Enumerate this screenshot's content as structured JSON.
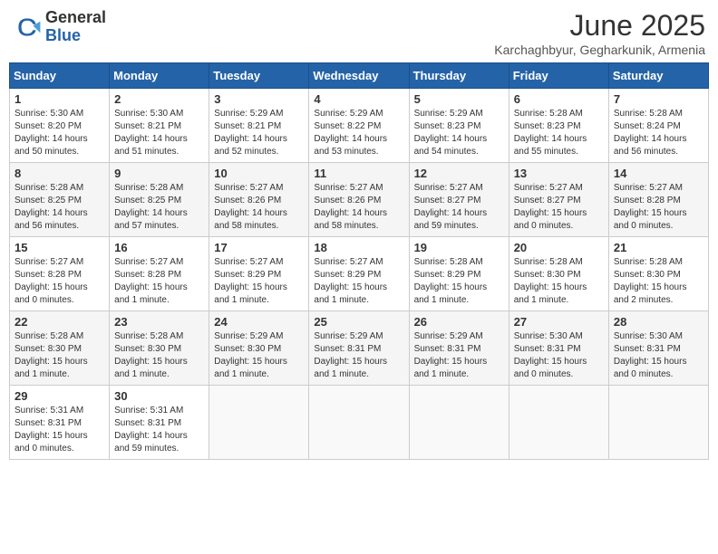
{
  "header": {
    "logo": {
      "general": "General",
      "blue": "Blue"
    },
    "title": "June 2025",
    "location": "Karchaghbyur, Gegharkunik, Armenia"
  },
  "calendar": {
    "days_of_week": [
      "Sunday",
      "Monday",
      "Tuesday",
      "Wednesday",
      "Thursday",
      "Friday",
      "Saturday"
    ],
    "weeks": [
      [
        {
          "day": "1",
          "sunrise": "Sunrise: 5:30 AM",
          "sunset": "Sunset: 8:20 PM",
          "daylight": "Daylight: 14 hours and 50 minutes."
        },
        {
          "day": "2",
          "sunrise": "Sunrise: 5:30 AM",
          "sunset": "Sunset: 8:21 PM",
          "daylight": "Daylight: 14 hours and 51 minutes."
        },
        {
          "day": "3",
          "sunrise": "Sunrise: 5:29 AM",
          "sunset": "Sunset: 8:21 PM",
          "daylight": "Daylight: 14 hours and 52 minutes."
        },
        {
          "day": "4",
          "sunrise": "Sunrise: 5:29 AM",
          "sunset": "Sunset: 8:22 PM",
          "daylight": "Daylight: 14 hours and 53 minutes."
        },
        {
          "day": "5",
          "sunrise": "Sunrise: 5:29 AM",
          "sunset": "Sunset: 8:23 PM",
          "daylight": "Daylight: 14 hours and 54 minutes."
        },
        {
          "day": "6",
          "sunrise": "Sunrise: 5:28 AM",
          "sunset": "Sunset: 8:23 PM",
          "daylight": "Daylight: 14 hours and 55 minutes."
        },
        {
          "day": "7",
          "sunrise": "Sunrise: 5:28 AM",
          "sunset": "Sunset: 8:24 PM",
          "daylight": "Daylight: 14 hours and 56 minutes."
        }
      ],
      [
        {
          "day": "8",
          "sunrise": "Sunrise: 5:28 AM",
          "sunset": "Sunset: 8:25 PM",
          "daylight": "Daylight: 14 hours and 56 minutes."
        },
        {
          "day": "9",
          "sunrise": "Sunrise: 5:28 AM",
          "sunset": "Sunset: 8:25 PM",
          "daylight": "Daylight: 14 hours and 57 minutes."
        },
        {
          "day": "10",
          "sunrise": "Sunrise: 5:27 AM",
          "sunset": "Sunset: 8:26 PM",
          "daylight": "Daylight: 14 hours and 58 minutes."
        },
        {
          "day": "11",
          "sunrise": "Sunrise: 5:27 AM",
          "sunset": "Sunset: 8:26 PM",
          "daylight": "Daylight: 14 hours and 58 minutes."
        },
        {
          "day": "12",
          "sunrise": "Sunrise: 5:27 AM",
          "sunset": "Sunset: 8:27 PM",
          "daylight": "Daylight: 14 hours and 59 minutes."
        },
        {
          "day": "13",
          "sunrise": "Sunrise: 5:27 AM",
          "sunset": "Sunset: 8:27 PM",
          "daylight": "Daylight: 15 hours and 0 minutes."
        },
        {
          "day": "14",
          "sunrise": "Sunrise: 5:27 AM",
          "sunset": "Sunset: 8:28 PM",
          "daylight": "Daylight: 15 hours and 0 minutes."
        }
      ],
      [
        {
          "day": "15",
          "sunrise": "Sunrise: 5:27 AM",
          "sunset": "Sunset: 8:28 PM",
          "daylight": "Daylight: 15 hours and 0 minutes."
        },
        {
          "day": "16",
          "sunrise": "Sunrise: 5:27 AM",
          "sunset": "Sunset: 8:28 PM",
          "daylight": "Daylight: 15 hours and 1 minute."
        },
        {
          "day": "17",
          "sunrise": "Sunrise: 5:27 AM",
          "sunset": "Sunset: 8:29 PM",
          "daylight": "Daylight: 15 hours and 1 minute."
        },
        {
          "day": "18",
          "sunrise": "Sunrise: 5:27 AM",
          "sunset": "Sunset: 8:29 PM",
          "daylight": "Daylight: 15 hours and 1 minute."
        },
        {
          "day": "19",
          "sunrise": "Sunrise: 5:28 AM",
          "sunset": "Sunset: 8:29 PM",
          "daylight": "Daylight: 15 hours and 1 minute."
        },
        {
          "day": "20",
          "sunrise": "Sunrise: 5:28 AM",
          "sunset": "Sunset: 8:30 PM",
          "daylight": "Daylight: 15 hours and 1 minute."
        },
        {
          "day": "21",
          "sunrise": "Sunrise: 5:28 AM",
          "sunset": "Sunset: 8:30 PM",
          "daylight": "Daylight: 15 hours and 2 minutes."
        }
      ],
      [
        {
          "day": "22",
          "sunrise": "Sunrise: 5:28 AM",
          "sunset": "Sunset: 8:30 PM",
          "daylight": "Daylight: 15 hours and 1 minute."
        },
        {
          "day": "23",
          "sunrise": "Sunrise: 5:28 AM",
          "sunset": "Sunset: 8:30 PM",
          "daylight": "Daylight: 15 hours and 1 minute."
        },
        {
          "day": "24",
          "sunrise": "Sunrise: 5:29 AM",
          "sunset": "Sunset: 8:30 PM",
          "daylight": "Daylight: 15 hours and 1 minute."
        },
        {
          "day": "25",
          "sunrise": "Sunrise: 5:29 AM",
          "sunset": "Sunset: 8:31 PM",
          "daylight": "Daylight: 15 hours and 1 minute."
        },
        {
          "day": "26",
          "sunrise": "Sunrise: 5:29 AM",
          "sunset": "Sunset: 8:31 PM",
          "daylight": "Daylight: 15 hours and 1 minute."
        },
        {
          "day": "27",
          "sunrise": "Sunrise: 5:30 AM",
          "sunset": "Sunset: 8:31 PM",
          "daylight": "Daylight: 15 hours and 0 minutes."
        },
        {
          "day": "28",
          "sunrise": "Sunrise: 5:30 AM",
          "sunset": "Sunset: 8:31 PM",
          "daylight": "Daylight: 15 hours and 0 minutes."
        }
      ],
      [
        {
          "day": "29",
          "sunrise": "Sunrise: 5:31 AM",
          "sunset": "Sunset: 8:31 PM",
          "daylight": "Daylight: 15 hours and 0 minutes."
        },
        {
          "day": "30",
          "sunrise": "Sunrise: 5:31 AM",
          "sunset": "Sunset: 8:31 PM",
          "daylight": "Daylight: 14 hours and 59 minutes."
        },
        null,
        null,
        null,
        null,
        null
      ]
    ]
  }
}
